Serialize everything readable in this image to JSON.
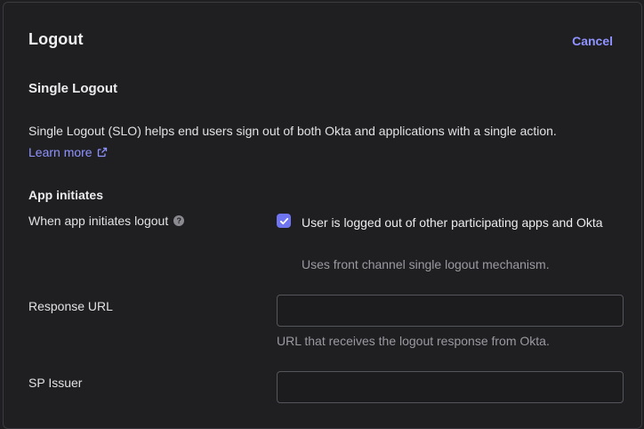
{
  "dialog": {
    "title": "Logout",
    "cancel_label": "Cancel"
  },
  "single_logout": {
    "heading": "Single Logout",
    "description": "Single Logout (SLO) helps end users sign out of both Okta and applications with a single action.",
    "learn_more_label": "Learn more"
  },
  "app_initiates": {
    "heading": "App initiates",
    "field_label": "When app initiates logout",
    "help_icon": "?",
    "checkbox_checked": true,
    "checkbox_label": "User is logged out of other participating apps and Okta",
    "checkbox_hint": "Uses front channel single logout mechanism."
  },
  "response_url": {
    "label": "Response URL",
    "value": "",
    "hint": "URL that receives the logout response from Okta."
  },
  "sp_issuer": {
    "label": "SP Issuer",
    "value": ""
  },
  "colors": {
    "accent": "#8f93ff",
    "checkbox": "#6f74f0",
    "background": "#1f1f22"
  }
}
